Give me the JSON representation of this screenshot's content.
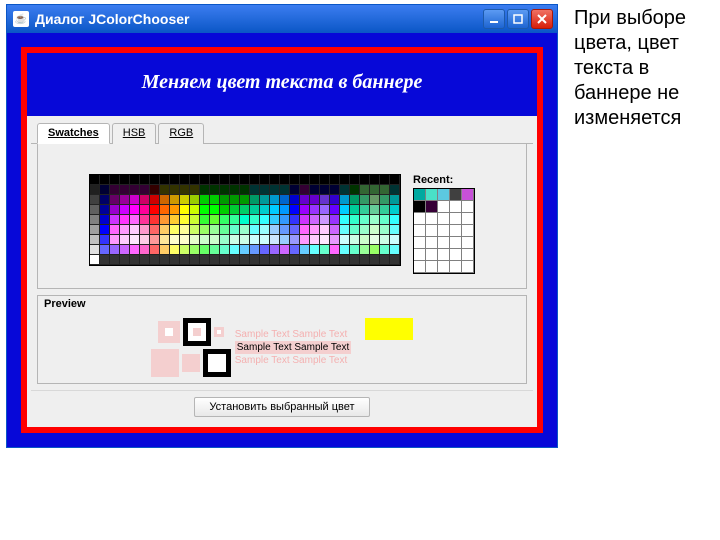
{
  "window": {
    "title": "Диалог JColorChooser"
  },
  "banner": {
    "text": "Меняем цвет текста в баннере"
  },
  "tabs": {
    "swatches": "Swatches",
    "hsb": "HSB",
    "rgb": "RGB"
  },
  "recent": {
    "label": "Recent:",
    "colors": [
      "#00a9a0",
      "#49e0c7",
      "#5cc8e0",
      "#404040",
      "#c751d8",
      "#000000",
      "#370037",
      "#ffffff",
      "#ffffff",
      "#ffffff"
    ]
  },
  "preview": {
    "title": "Preview",
    "sample1a": "Sample Text",
    "sample1b": "Sample Text",
    "sample2a": "Sample Text",
    "sample2b": "Sample Text",
    "sample3a": "Sample Text",
    "sample3b": "Sample Text"
  },
  "button": {
    "apply": "Установить выбранный цвет"
  },
  "caption": {
    "text": "При выборе цвета, цвет текста в баннере не изменяется"
  },
  "swatch_colors": [
    [
      "#000000",
      "#000000",
      "#000000",
      "#000000",
      "#000000",
      "#000000",
      "#000000",
      "#000000",
      "#000000",
      "#000000",
      "#000000",
      "#000000",
      "#000000",
      "#000000",
      "#000000",
      "#000000",
      "#000000",
      "#000000",
      "#000000",
      "#000000",
      "#000000",
      "#000000",
      "#000000",
      "#000000",
      "#000000",
      "#000000",
      "#000000",
      "#000000",
      "#000000",
      "#000000",
      "#000000"
    ],
    [
      "#202020",
      "#000033",
      "#330033",
      "#330033",
      "#330033",
      "#330033",
      "#330000",
      "#333300",
      "#333300",
      "#333300",
      "#333300",
      "#003300",
      "#003300",
      "#003300",
      "#003300",
      "#003300",
      "#003333",
      "#003333",
      "#003333",
      "#003333",
      "#000033",
      "#330033",
      "#000033",
      "#000033",
      "#000033",
      "#003333",
      "#003300",
      "#336633",
      "#336633",
      "#336633",
      "#003333"
    ],
    [
      "#404040",
      "#000066",
      "#660066",
      "#990099",
      "#cc00cc",
      "#cc0066",
      "#cc0000",
      "#cc6600",
      "#cc9900",
      "#cccc00",
      "#99cc00",
      "#00cc00",
      "#00cc00",
      "#009900",
      "#009900",
      "#009900",
      "#009966",
      "#009999",
      "#0099cc",
      "#0066cc",
      "#0000cc",
      "#6600cc",
      "#6600cc",
      "#6633cc",
      "#3300cc",
      "#0099cc",
      "#009966",
      "#339966",
      "#669966",
      "#339966",
      "#009999"
    ],
    [
      "#606060",
      "#000099",
      "#9900cc",
      "#cc00ff",
      "#ff00ff",
      "#ff0099",
      "#ff0000",
      "#ff6600",
      "#ff9900",
      "#ffff00",
      "#ccff00",
      "#00ff00",
      "#00ff00",
      "#00cc00",
      "#00cc33",
      "#00cc66",
      "#00cc99",
      "#00cccc",
      "#00ccff",
      "#0099ff",
      "#0000ff",
      "#9900ff",
      "#9933ff",
      "#9966ff",
      "#6600ff",
      "#00ccff",
      "#00cc99",
      "#33cc99",
      "#66cc99",
      "#33cc99",
      "#00cccc"
    ],
    [
      "#808080",
      "#0000cc",
      "#cc33ff",
      "#ff33ff",
      "#ff66ff",
      "#ff3399",
      "#ff3333",
      "#ff9933",
      "#ffcc33",
      "#ffff33",
      "#ccff33",
      "#33ff33",
      "#66ff33",
      "#33ff66",
      "#33ff99",
      "#00ffcc",
      "#33ffcc",
      "#33ffff",
      "#33ccff",
      "#3399ff",
      "#3333ff",
      "#cc33ff",
      "#cc66ff",
      "#cc99ff",
      "#9933ff",
      "#33ffff",
      "#33ffcc",
      "#66ffcc",
      "#99ffcc",
      "#66ffcc",
      "#33ffff"
    ],
    [
      "#a0a0a0",
      "#0000ff",
      "#ff66ff",
      "#ff99ff",
      "#ffccff",
      "#ff99cc",
      "#ff6666",
      "#ffcc66",
      "#ffff66",
      "#ffff99",
      "#ccff66",
      "#99ff66",
      "#99ff99",
      "#66ff99",
      "#66ffcc",
      "#99ffcc",
      "#66ffff",
      "#99ffff",
      "#99ccff",
      "#6699ff",
      "#6666ff",
      "#ff66ff",
      "#ff99ff",
      "#ffccff",
      "#cc66ff",
      "#66ffff",
      "#66ffcc",
      "#99ffcc",
      "#ccffcc",
      "#99ffcc",
      "#66ffff"
    ],
    [
      "#c0c0c0",
      "#3333ff",
      "#ff99ff",
      "#ffccff",
      "#ffe6ff",
      "#ffcce6",
      "#ff9999",
      "#ffe699",
      "#ffffcc",
      "#ffffcc",
      "#e6ffcc",
      "#ccffcc",
      "#ccffcc",
      "#99ffcc",
      "#ccffe6",
      "#ccffe6",
      "#ccffff",
      "#ccffff",
      "#cce6ff",
      "#99ccff",
      "#9999ff",
      "#ff99ff",
      "#ffccff",
      "#ffe6ff",
      "#e699ff",
      "#ccffff",
      "#ccffe6",
      "#ccffcc",
      "#e6ffe6",
      "#ccffe6",
      "#ccffff"
    ],
    [
      "#e0e0e0",
      "#6666ff",
      "#9966ff",
      "#cc66ff",
      "#ff66ff",
      "#ff66cc",
      "#ff6666",
      "#ffcc66",
      "#ffff66",
      "#ccff66",
      "#99ff66",
      "#66ff66",
      "#66ff99",
      "#66ffcc",
      "#66ffff",
      "#66ccff",
      "#6699ff",
      "#6666ff",
      "#9966ff",
      "#cc66ff",
      "#6666ff",
      "#66ccff",
      "#66ffff",
      "#66ffcc",
      "#ff66ff",
      "#66ffff",
      "#66ffcc",
      "#99ff99",
      "#99ff66",
      "#66ffcc",
      "#66ffff"
    ],
    [
      "#ffffff",
      "#333333",
      "#333333",
      "#333333",
      "#333333",
      "#333333",
      "#333333",
      "#333333",
      "#333333",
      "#333333",
      "#333333",
      "#333333",
      "#333333",
      "#333333",
      "#333333",
      "#333333",
      "#333333",
      "#333333",
      "#333333",
      "#333333",
      "#333333",
      "#333333",
      "#333333",
      "#333333",
      "#333333",
      "#333333",
      "#333333",
      "#333333",
      "#333333",
      "#333333",
      "#333333"
    ]
  ]
}
